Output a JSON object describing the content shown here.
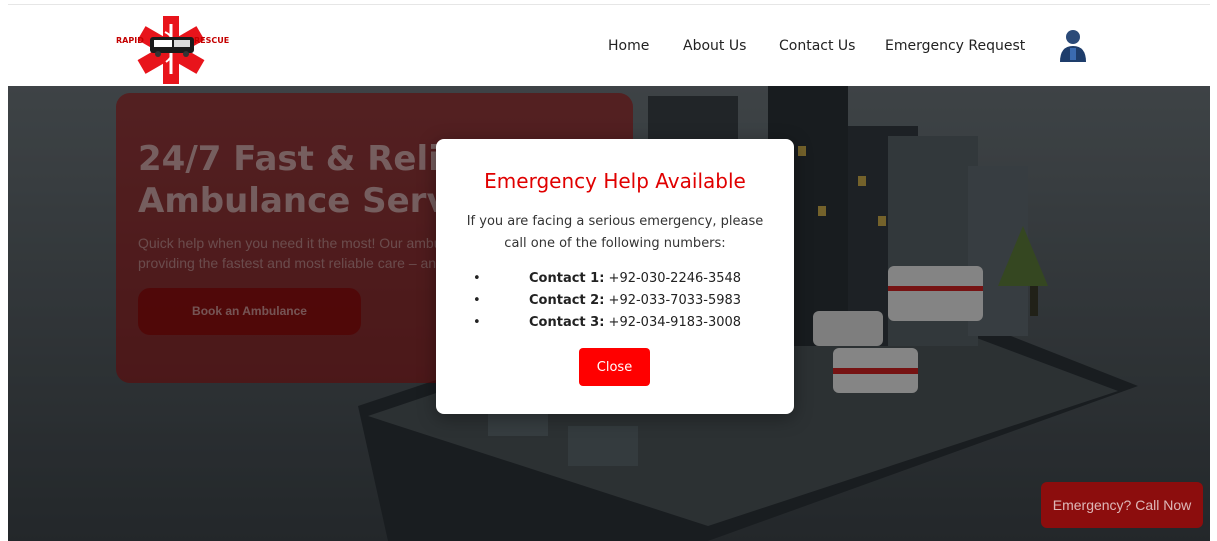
{
  "navbar": {
    "logo": {
      "left_text": "RAPID",
      "right_text": "RESCUE"
    },
    "links": [
      "Home",
      "About Us",
      "Contact Us",
      "Emergency Request"
    ],
    "user_icon": "user-avatar-icon"
  },
  "hero": {
    "title": "24/7 Fast & Reliable\nAmbulance Services",
    "text": "Quick help when you need it the most! Our ambulance team is\nproviding the fastest and most reliable care – anytime.",
    "button": "Book an Ambulance"
  },
  "modal": {
    "title": "Emergency Help Available",
    "message": "If you are facing a serious emergency, please call one of the following numbers:",
    "contacts": [
      {
        "label": "Contact 1:",
        "number": "+92-030-2246-3548"
      },
      {
        "label": "Contact 2:",
        "number": "+92-033-7033-5983"
      },
      {
        "label": "Contact 3:",
        "number": "+92-034-9183-3008"
      }
    ],
    "bullet": "•",
    "close": "Close"
  },
  "floating_button": "Emergency? Call Now",
  "colors": {
    "accent_red": "#ff0000",
    "title_red": "#e00000",
    "dark_red": "#8c0d0d"
  }
}
